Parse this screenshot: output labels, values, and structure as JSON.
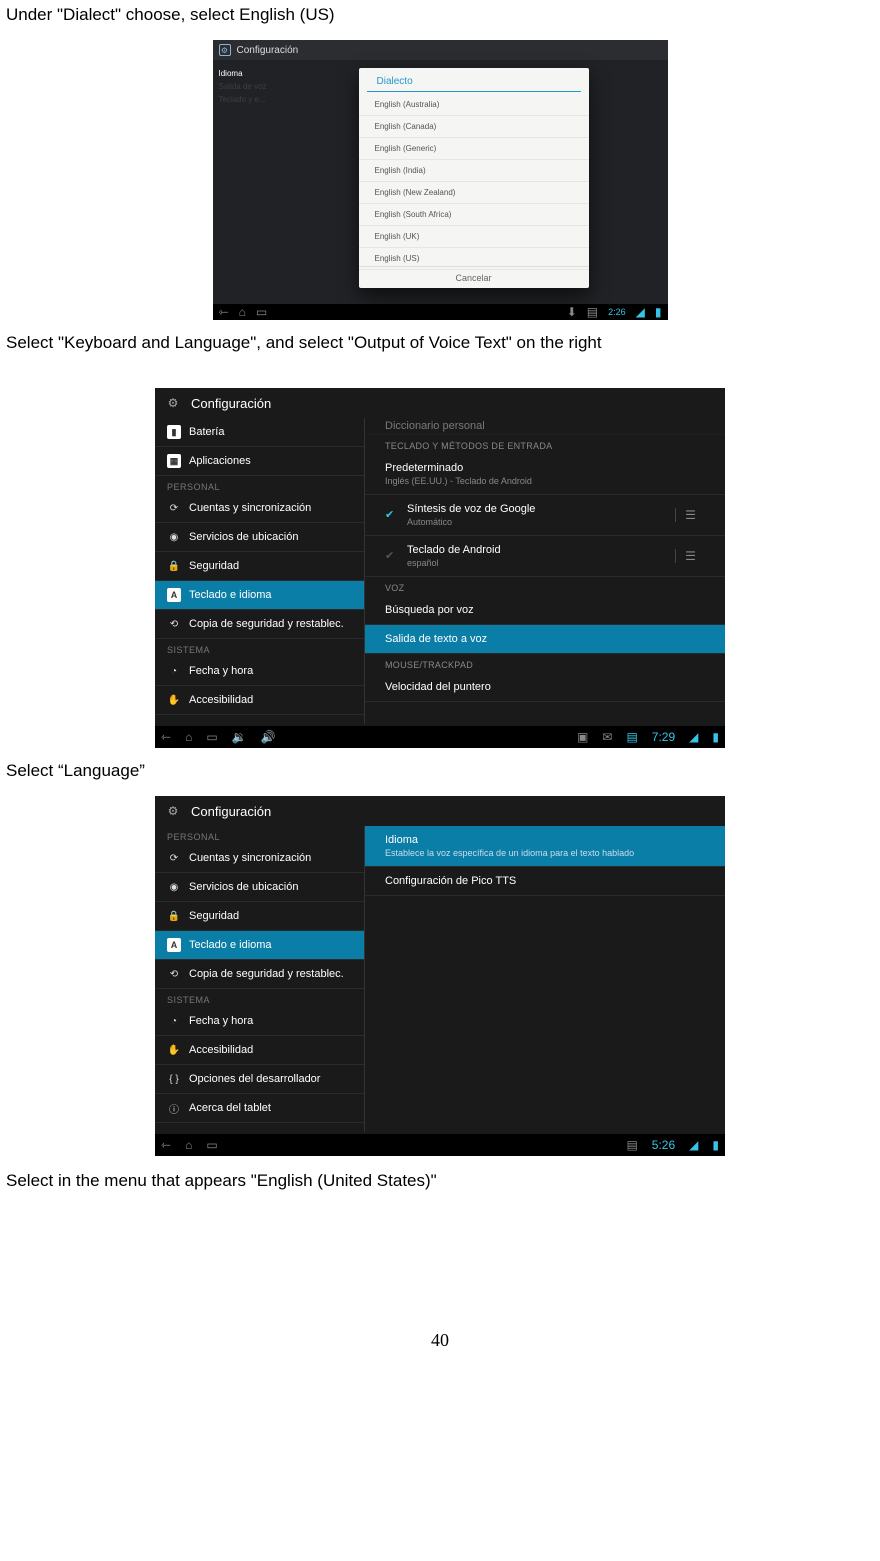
{
  "instructions": {
    "i1": "Under \"Dialect\" choose, select English (US)",
    "i2": "Select \"Keyboard and Language\", and select \"Output of Voice Text\" on the right",
    "i3": "Select “Language”",
    "i4": "Select in the menu that appears \"English (United States)\""
  },
  "page_number": "40",
  "shot1": {
    "header": "Configuración",
    "dialog_title": "Dialecto",
    "options": [
      "English (Australia)",
      "English (Canada)",
      "English (Generic)",
      "English (India)",
      "English (New Zealand)",
      "English (South Africa)",
      "English (UK)",
      "English (US)"
    ],
    "cancel": "Cancelar",
    "left_items": [
      "Idioma",
      "Salida de voz",
      "Teclado y e..."
    ],
    "clock": "2:26"
  },
  "shot2": {
    "header": "Configuración",
    "left": {
      "items_top": [
        "Batería",
        "Aplicaciones"
      ],
      "cat1": "PERSONAL",
      "items_personal": [
        "Cuentas y sincronización",
        "Servicios de ubicación",
        "Seguridad",
        "Teclado e idioma",
        "Copia de seguridad y restablec."
      ],
      "cat2": "SISTEMA",
      "items_sistema": [
        "Fecha y hora",
        "Accesibilidad"
      ]
    },
    "right": {
      "scroll_hint": "Diccionario personal",
      "cat1": "TECLADO Y MÉTODOS DE ENTRADA",
      "pred": {
        "title": "Predeterminado",
        "sub": "Inglés (EE.UU.) - Teclado de Android"
      },
      "google": {
        "title": "Síntesis de voz de Google",
        "sub": "Automático"
      },
      "android": {
        "title": "Teclado de Android",
        "sub": "español"
      },
      "cat2": "VOZ",
      "voice_search": "Búsqueda por voz",
      "tts_out": "Salida de texto a voz",
      "cat3": "MOUSE/TRACKPAD",
      "pointer": "Velocidad del puntero"
    },
    "clock": "7:29"
  },
  "shot3": {
    "header": "Configuración",
    "left": {
      "cat1": "PERSONAL",
      "items_personal": [
        "Cuentas y sincronización",
        "Servicios de ubicación",
        "Seguridad",
        "Teclado e idioma",
        "Copia de seguridad y restablec."
      ],
      "cat2": "SISTEMA",
      "items_sistema": [
        "Fecha y hora",
        "Accesibilidad",
        "Opciones del desarrollador",
        "Acerca del tablet"
      ]
    },
    "right": {
      "idioma": {
        "title": "Idioma",
        "sub": "Establece la voz específica de un idioma para el texto hablado"
      },
      "pico": "Configuración de Pico TTS"
    },
    "clock": "5:26"
  }
}
